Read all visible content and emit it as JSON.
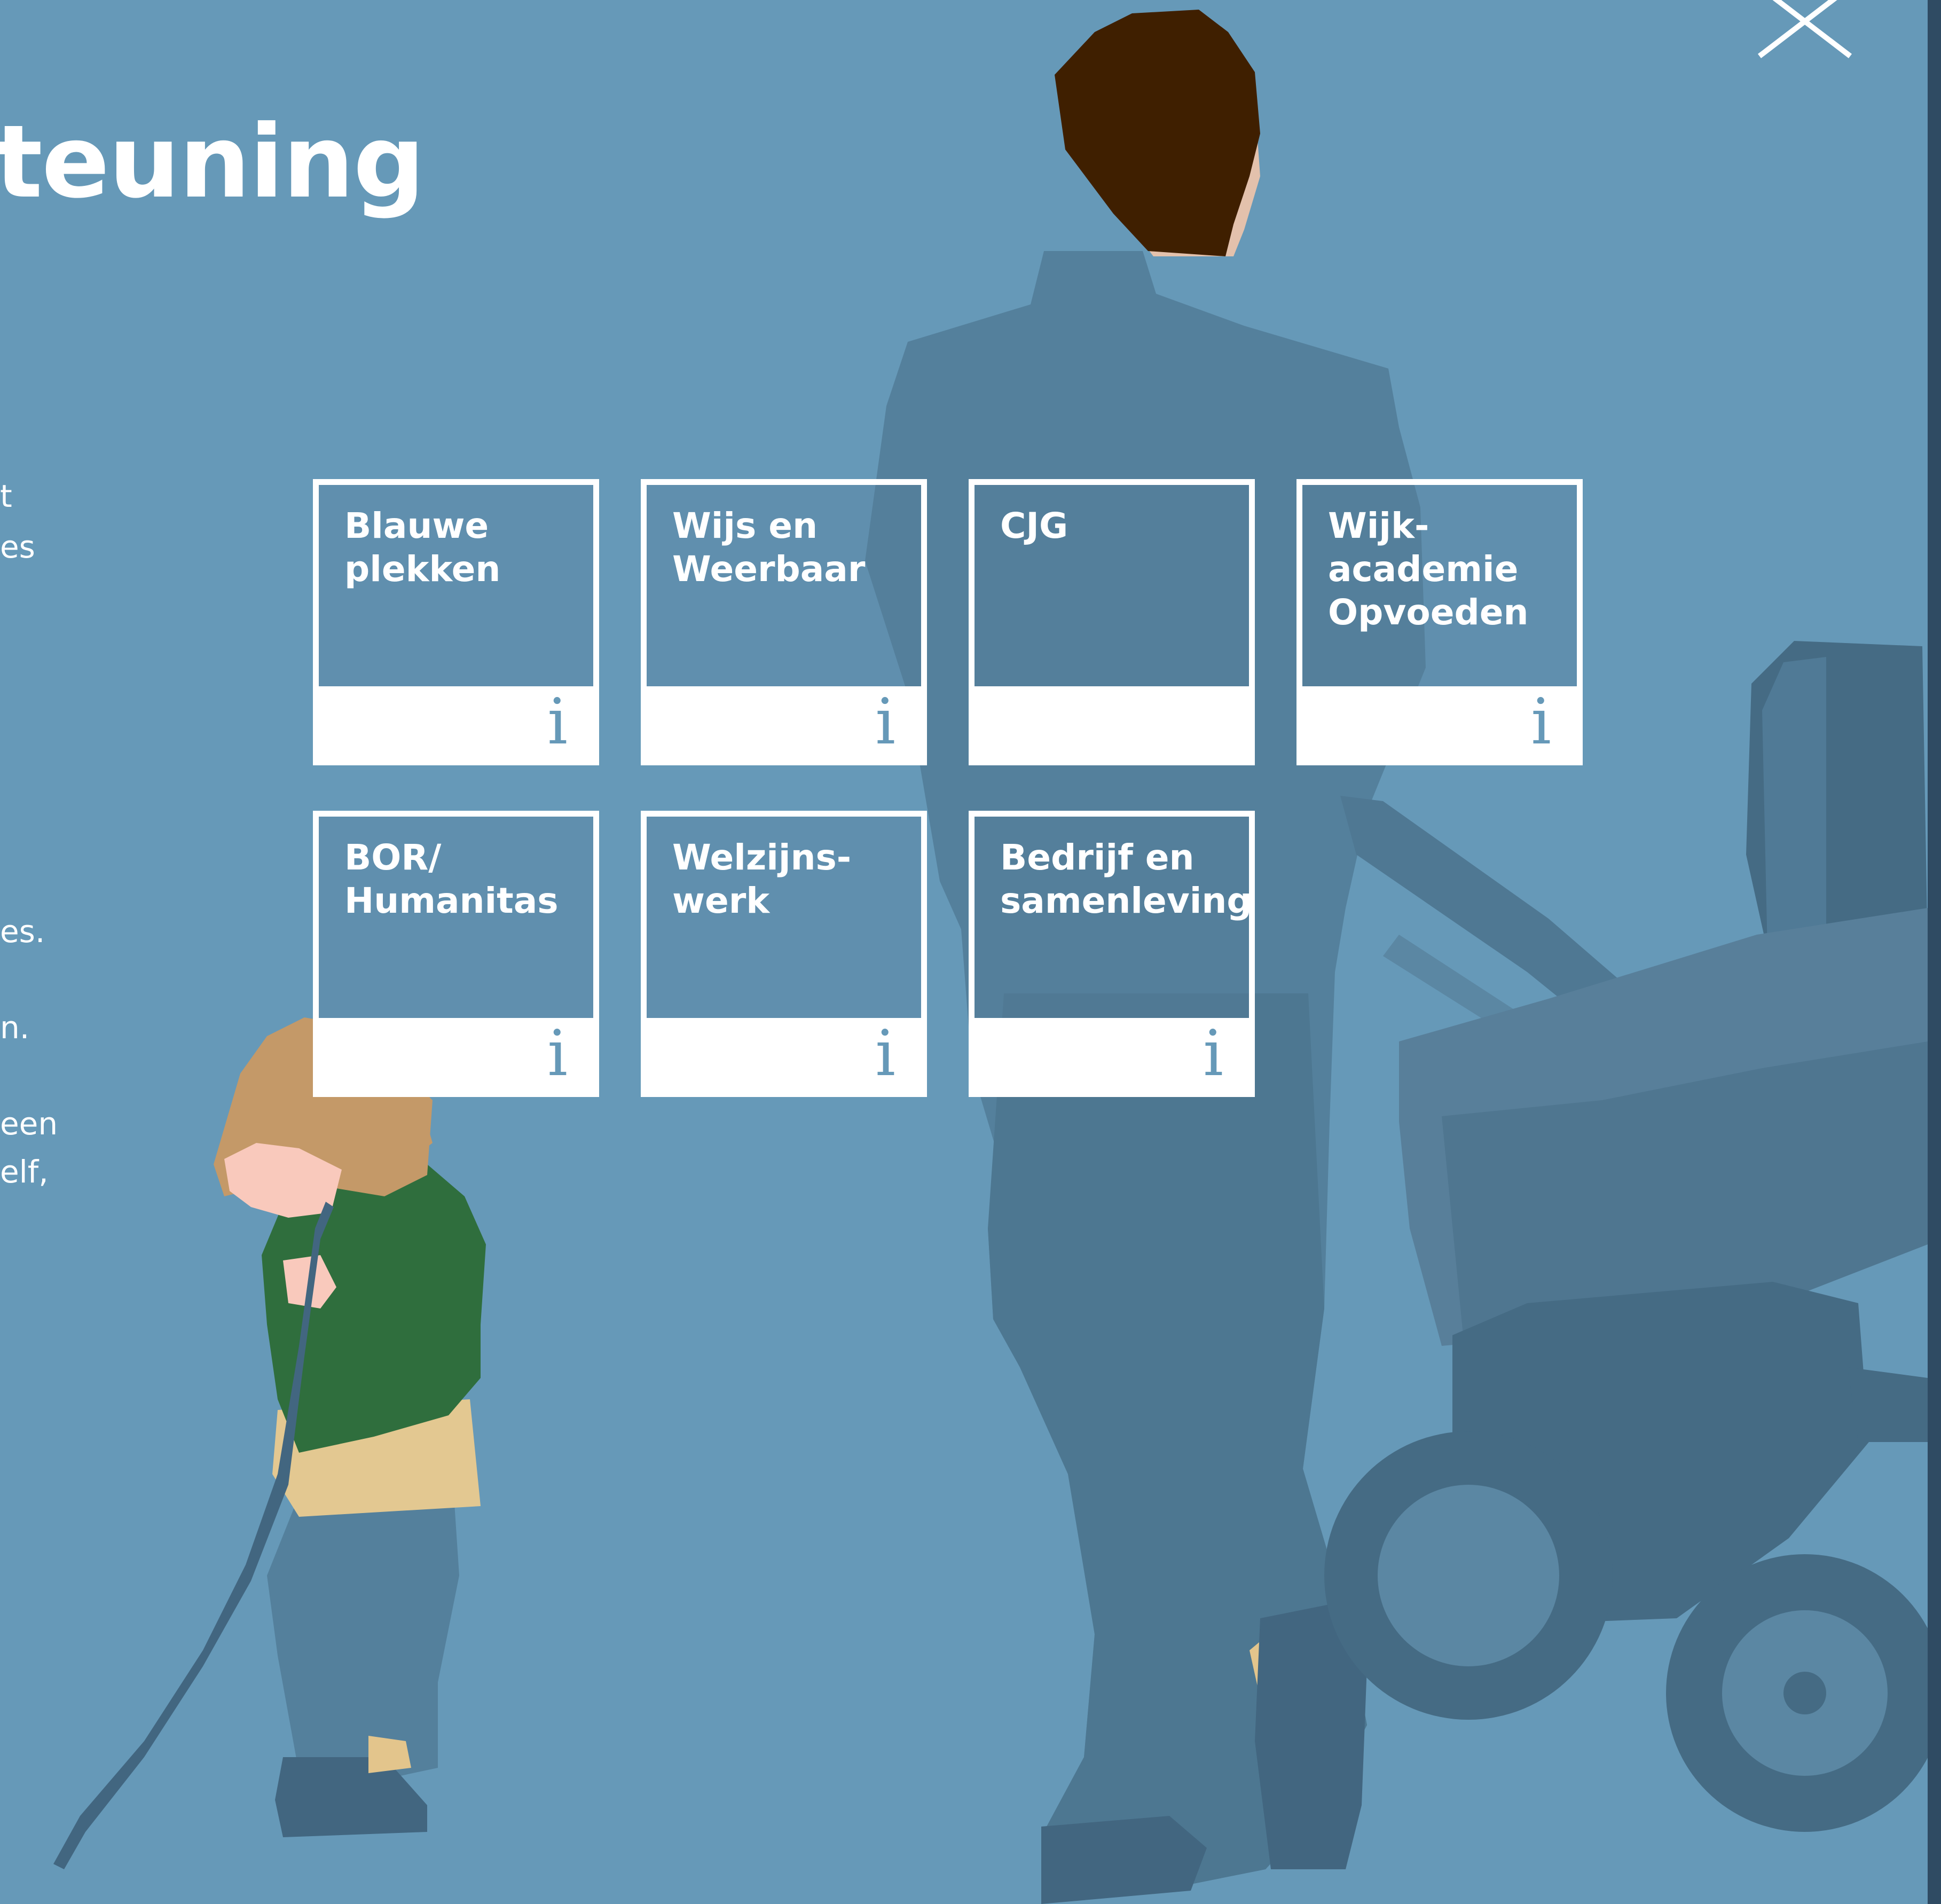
{
  "header": {
    "title": "teuning",
    "close_icon": "close-icon"
  },
  "intro_text_fragments": [
    "t",
    "es",
    "es.",
    "n.",
    "een",
    "elf,"
  ],
  "tiles": [
    {
      "label": "Blauwe\nplekken",
      "info_icon": "info-icon",
      "has_info": true
    },
    {
      "label": "Wijs en\nWeerbaar",
      "info_icon": "info-icon",
      "has_info": true
    },
    {
      "label": "CJG",
      "info_icon": "",
      "has_info": false
    },
    {
      "label": "Wijk-\nacademie\nOpvoeden",
      "info_icon": "info-icon",
      "has_info": true
    },
    {
      "label": "BOR/\nHumanitas",
      "info_icon": "info-icon",
      "has_info": true
    },
    {
      "label": "Welzijns-\nwerk",
      "info_icon": "info-icon",
      "has_info": true
    },
    {
      "label": "Bedrijf en\nsamenleving",
      "info_icon": "info-icon",
      "has_info": true
    }
  ],
  "info_glyph": "i",
  "colors": {
    "background": "#6699b8",
    "tile_border": "#ffffff",
    "info_icon": "#6699b8",
    "child_sweater": "#2f6e3d",
    "man_hair": "#3f1f00"
  }
}
